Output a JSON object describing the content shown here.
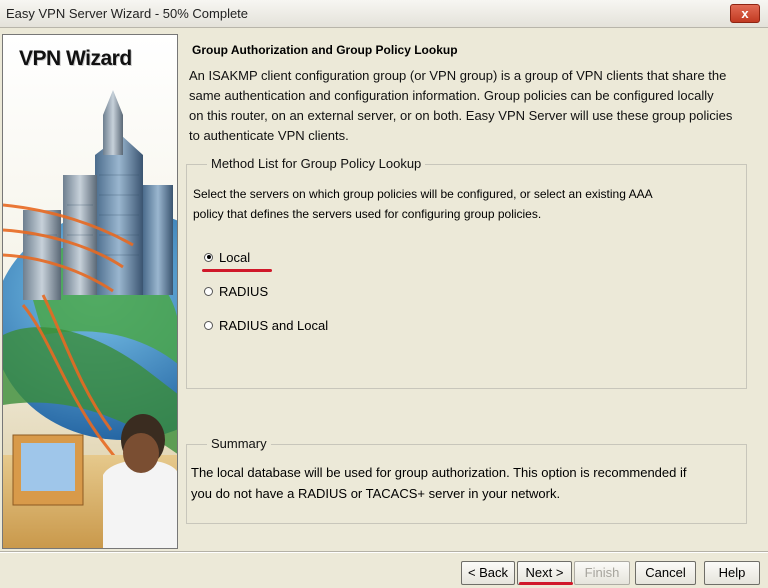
{
  "window": {
    "title": "Easy VPN Server Wizard - 50% Complete",
    "close_label": "x"
  },
  "sidebar": {
    "title": "VPN Wizard"
  },
  "page": {
    "heading": "Group Authorization and Group Policy Lookup",
    "intro_lines": [
      "An ISAKMP client configuration group (or VPN group) is a group of VPN clients that share the",
      "same authentication and configuration information. Group policies can be configured locally",
      "on this router, on an external server, or on both. Easy VPN Server will use these group policies",
      "to authenticate VPN clients."
    ]
  },
  "method_list": {
    "legend": "Method List for Group Policy Lookup",
    "description_lines": [
      "Select the servers on which group policies will be configured, or select an existing AAA",
      "policy that defines the servers used for configuring group policies."
    ],
    "options": [
      {
        "label": "Local",
        "checked": true
      },
      {
        "label": "RADIUS",
        "checked": false
      },
      {
        "label": "RADIUS and Local",
        "checked": false
      }
    ]
  },
  "summary": {
    "legend": "Summary",
    "text_lines": [
      "The local database will be used for group authorization. This option is recommended if",
      "you do not have a RADIUS or TACACS+ server in your network."
    ]
  },
  "buttons": {
    "back": "< Back",
    "next": "Next >",
    "finish": "Finish",
    "cancel": "Cancel",
    "help": "Help"
  },
  "colors": {
    "annotation_mark": "#d0182a"
  }
}
